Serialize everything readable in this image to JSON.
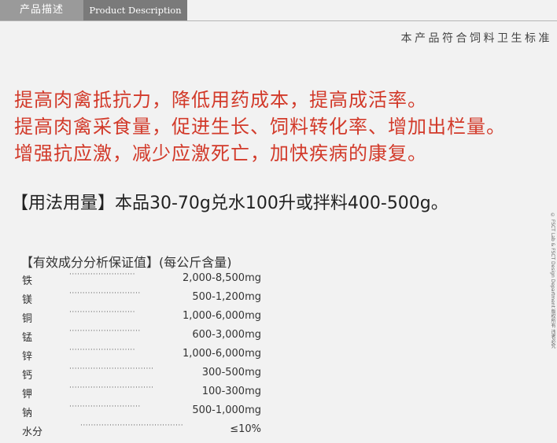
{
  "header": {
    "tab_cn": "产品描述",
    "tab_en": "Product Description"
  },
  "standard_text": "本产品符合饲料卫生标准",
  "claims": [
    "提高肉禽抵抗力，降低用药成本，提高成活率。",
    "提高肉禽采食量，促进生长、饲料转化率、增加出栏量。",
    "增强抗应激，减少应激死亡，加快疾病的康复。"
  ],
  "usage": "【用法用量】本品30-70g兑水100升或拌料400-500g。",
  "table": {
    "title": "【有效成分分析保证值】(每公斤含量)",
    "rows": [
      {
        "name": "铁",
        "dots": "·························",
        "value": "2,000-8,500mg"
      },
      {
        "name": "镁",
        "dots": "···························",
        "value": "500-1,200mg"
      },
      {
        "name": "铜",
        "dots": "·························",
        "value": "1,000-6,000mg"
      },
      {
        "name": "锰",
        "dots": "···························",
        "value": "600-3,000mg"
      },
      {
        "name": "锌",
        "dots": "·························",
        "value": "1,000-6,000mg"
      },
      {
        "name": "钙",
        "dots": "································",
        "value": "300-500mg"
      },
      {
        "name": "钾",
        "dots": "································",
        "value": "100-300mg"
      },
      {
        "name": "钠",
        "dots": "···························",
        "value": "500-1,000mg"
      },
      {
        "name": "水分",
        "dots": "·······································",
        "value": "≤10%"
      }
    ]
  },
  "credit": "© FSCT Lab & FSCT Design Department 版权所有 违者必究"
}
